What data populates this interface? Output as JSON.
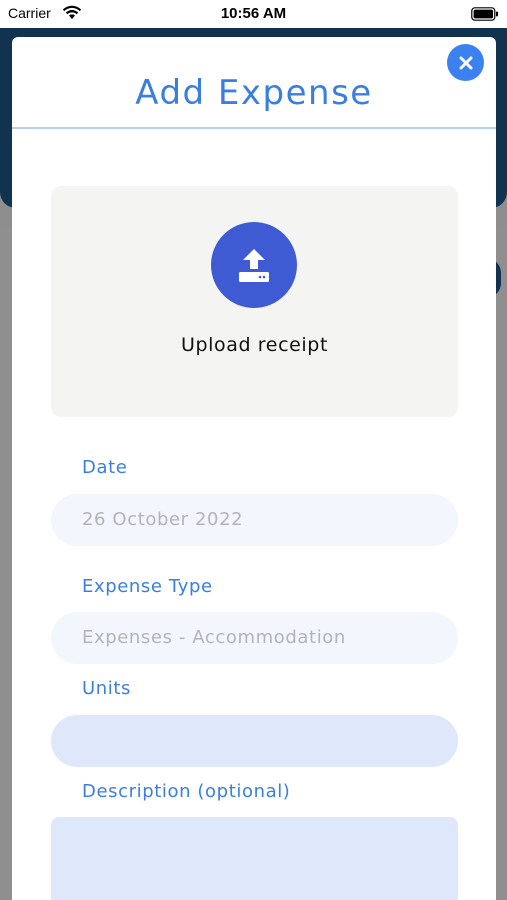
{
  "status_bar": {
    "carrier": "Carrier",
    "time": "10:56 AM",
    "icons": [
      "wifi-icon",
      "battery-icon"
    ]
  },
  "modal": {
    "title": "Add Expense",
    "close_icon": "close-icon",
    "upload": {
      "label": "Upload receipt",
      "icon": "upload-icon"
    },
    "fields": {
      "date": {
        "label": "Date",
        "value": "26 October 2022"
      },
      "expense_type": {
        "label": "Expense Type",
        "value": "Expenses - Accommodation"
      },
      "units": {
        "label": "Units",
        "value": ""
      },
      "description": {
        "label": "Description (optional)",
        "value": ""
      }
    }
  },
  "colors": {
    "accent": "#3a7fe0",
    "close_button": "#3b82f0",
    "upload_circle": "#3f5bd3",
    "input_readonly": "#f3f6fd",
    "input_editable": "#dfe7fb",
    "background_header": "#12334f"
  }
}
